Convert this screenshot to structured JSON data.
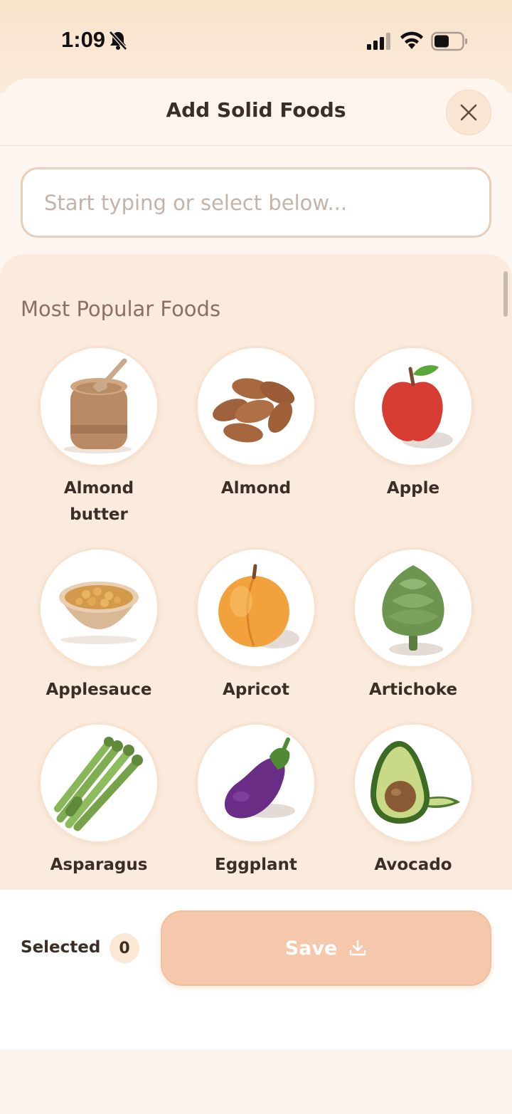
{
  "status_bar": {
    "time": "1:09"
  },
  "sheet": {
    "title": "Add Solid Foods",
    "search": {
      "value": "",
      "placeholder": "Start typing or select below..."
    },
    "section_title": "Most Popular Foods",
    "foods": [
      {
        "label": "Almond butter",
        "line1": "Almond",
        "line2": "butter",
        "icon": "almond-butter-jar"
      },
      {
        "label": "Almond",
        "line1": "Almond",
        "line2": "",
        "icon": "almonds"
      },
      {
        "label": "Apple",
        "line1": "Apple",
        "line2": "",
        "icon": "apple"
      },
      {
        "label": "Applesauce",
        "line1": "Applesauce",
        "line2": "",
        "icon": "applesauce-bowl"
      },
      {
        "label": "Apricot",
        "line1": "Apricot",
        "line2": "",
        "icon": "apricot"
      },
      {
        "label": "Artichoke",
        "line1": "Artichoke",
        "line2": "",
        "icon": "artichoke"
      },
      {
        "label": "Asparagus",
        "line1": "Asparagus",
        "line2": "",
        "icon": "asparagus"
      },
      {
        "label": "Eggplant",
        "line1": "Eggplant",
        "line2": "",
        "icon": "eggplant"
      },
      {
        "label": "Avocado",
        "line1": "Avocado",
        "line2": "",
        "icon": "avocado"
      }
    ]
  },
  "footer": {
    "selected_label": "Selected",
    "selected_count": "0",
    "save_label": "Save"
  },
  "colors": {
    "accent": "#f5c7ab",
    "panel": "#fbebdd",
    "text": "#3b2e26"
  }
}
